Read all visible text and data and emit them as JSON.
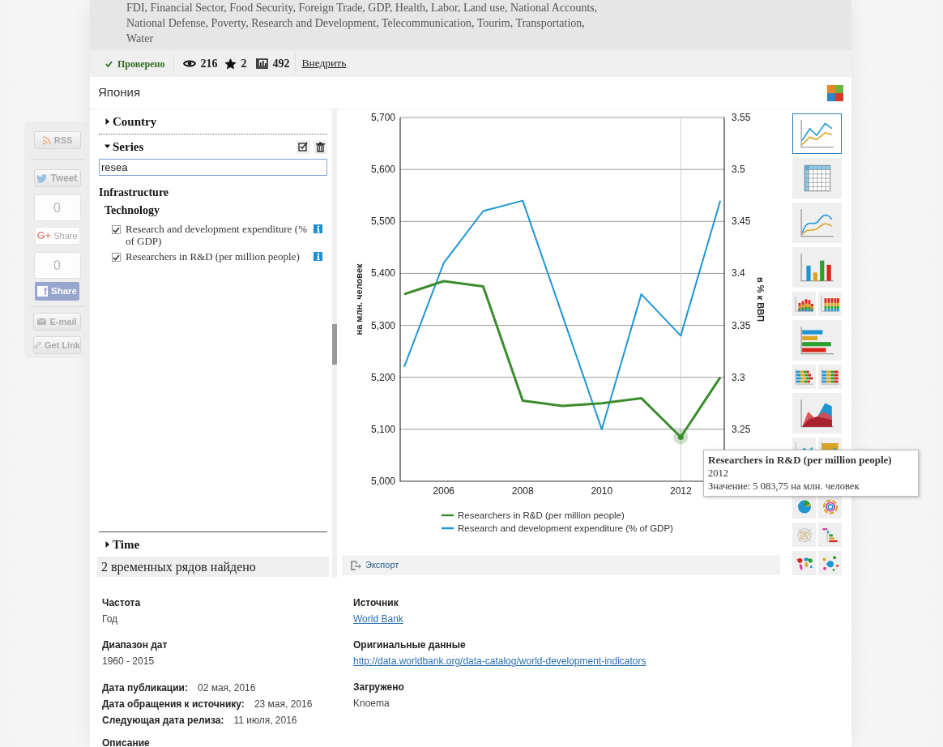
{
  "tags_text": "FDI, Financial Sector, Food Security, Foreign Trade, GDP, Health, Labor, Land use, National Accounts, National Defense, Poverty, Research and Development, Telecommunication, Tourim, Transportation, Water",
  "toolbar": {
    "verified": "Проверено",
    "views": "216",
    "stars": "2",
    "charts": "492",
    "embed": "Внедрить"
  },
  "title": "Япония",
  "social": [
    {
      "kind": "rss",
      "label": "RSS"
    },
    {
      "kind": "tweet",
      "label": "Tweet"
    },
    {
      "kind": "counter",
      "label": "0"
    },
    {
      "kind": "gplus",
      "label": "Share",
      "icon_text": "G+"
    },
    {
      "kind": "counter",
      "label": "0"
    },
    {
      "kind": "facebook",
      "label": "Share",
      "icon_text": "f"
    },
    {
      "kind": "email",
      "label": "E-mail"
    },
    {
      "kind": "link",
      "label": "Get Link"
    }
  ],
  "selector": {
    "country": {
      "title": "Country",
      "expanded": false
    },
    "series": {
      "title": "Series",
      "expanded": true,
      "search_value": "resea",
      "tree": [
        {
          "label": "Infrastructure",
          "children": [
            {
              "label": "Technology",
              "children": [
                {
                  "label": "Research and development expenditure (% of GDP)",
                  "checked": true
                },
                {
                  "label": "Researchers in R&D (per million people)",
                  "checked": true
                }
              ]
            }
          ]
        }
      ]
    },
    "time": {
      "title": "Time",
      "expanded": false
    },
    "found": "2 временных рядов найдено"
  },
  "chart": {
    "chart_data": {
      "type": "line",
      "x": [
        2005,
        2006,
        2007,
        2008,
        2009,
        2010,
        2011,
        2012,
        2013
      ],
      "xlim": [
        2004.9,
        2013.1
      ],
      "xticks": [
        {
          "value": 2006,
          "label": "2006"
        },
        {
          "value": 2008,
          "label": "2008"
        },
        {
          "value": 2010,
          "label": "2010"
        },
        {
          "value": 2012,
          "label": "2012"
        }
      ],
      "ylabel": "на млн. человек",
      "ylim": [
        5000,
        5700
      ],
      "yticks": [
        {
          "value": 5000,
          "label": "5,000"
        },
        {
          "value": 5100,
          "label": "5,100"
        },
        {
          "value": 5200,
          "label": "5,200"
        },
        {
          "value": 5300,
          "label": "5,300"
        },
        {
          "value": 5400,
          "label": "5,400"
        },
        {
          "value": 5500,
          "label": "5,500"
        },
        {
          "value": 5600,
          "label": "5,600"
        },
        {
          "value": 5700,
          "label": "5,700"
        }
      ],
      "y2label": "в % к ВВП",
      "y2lim": [
        3.2,
        3.55
      ],
      "y2ticks": [
        3.25,
        3.3,
        3.35,
        3.4,
        3.45,
        3.5,
        3.55
      ],
      "series": [
        {
          "name": "Researchers in R&D (per million people)",
          "color": "#3d8b2f",
          "values": [
            5360,
            5385,
            5375,
            5155,
            5145,
            5150,
            5160,
            5085,
            5200
          ]
        },
        {
          "name": "Research and development expenditure (% of GDP)",
          "color": "#1e96d3",
          "axis": "y2",
          "values": [
            3.31,
            3.41,
            3.46,
            3.47,
            3.36,
            3.25,
            3.38,
            3.34,
            3.47
          ]
        }
      ],
      "grid": true,
      "legend": true,
      "ref_lines": [
        {
          "axis": "x",
          "value": 2012
        }
      ]
    },
    "tooltip": {
      "title": "Researchers in R&D (per million people)",
      "period": "2012",
      "value": "Значение: 5 083,75 на млн. человек"
    },
    "export": "Экспорт"
  },
  "chart_type_rows": [
    [
      {
        "kind": "line",
        "selected": true
      }
    ],
    [
      {
        "kind": "table",
        "selected": false
      }
    ],
    [
      {
        "kind": "spline",
        "selected": false
      }
    ],
    [
      {
        "kind": "column",
        "selected": false
      }
    ],
    [
      {
        "kind": "stacked-column",
        "selected": false
      },
      {
        "kind": "percent-column",
        "selected": false
      }
    ],
    [
      {
        "kind": "bar",
        "selected": false
      }
    ],
    [
      {
        "kind": "stacked-bar",
        "selected": false
      },
      {
        "kind": "percent-bar",
        "selected": false
      }
    ],
    [
      {
        "kind": "area",
        "selected": false
      }
    ],
    [
      {
        "kind": "stacked-area",
        "selected": false
      },
      {
        "kind": "percent-area",
        "selected": false
      }
    ],
    [
      {
        "kind": "pie",
        "selected": false
      },
      {
        "kind": "rings",
        "selected": false
      }
    ],
    [
      {
        "kind": "radar",
        "selected": false
      },
      {
        "kind": "steps",
        "selected": false
      }
    ],
    [
      {
        "kind": "map",
        "selected": false
      },
      {
        "kind": "bubble",
        "selected": false
      }
    ]
  ],
  "details": {
    "left": [
      {
        "kind": "block",
        "label": "Частота",
        "value": "Год"
      },
      {
        "kind": "block",
        "label": "Диапазон дат",
        "value": "1960 - 2015"
      },
      {
        "kind": "inline",
        "label": "Дата публикации:",
        "value": "02 мая, 2016"
      },
      {
        "kind": "inline",
        "label": "Дата обращения к источнику:",
        "value": "23 мая, 2016"
      },
      {
        "kind": "inline",
        "label": "Следующая дата релиза:",
        "value": "11 июля, 2016"
      },
      {
        "kind": "heading",
        "label": "Описание"
      }
    ],
    "right": [
      {
        "kind": "link",
        "label": "Источник",
        "value": "World Bank"
      },
      {
        "kind": "link",
        "label": "Оригинальные данные",
        "value": "http://data.worldbank.org/data-catalog/world-development-indicators"
      },
      {
        "kind": "block",
        "label": "Загружено",
        "value": "Knoema"
      }
    ]
  }
}
